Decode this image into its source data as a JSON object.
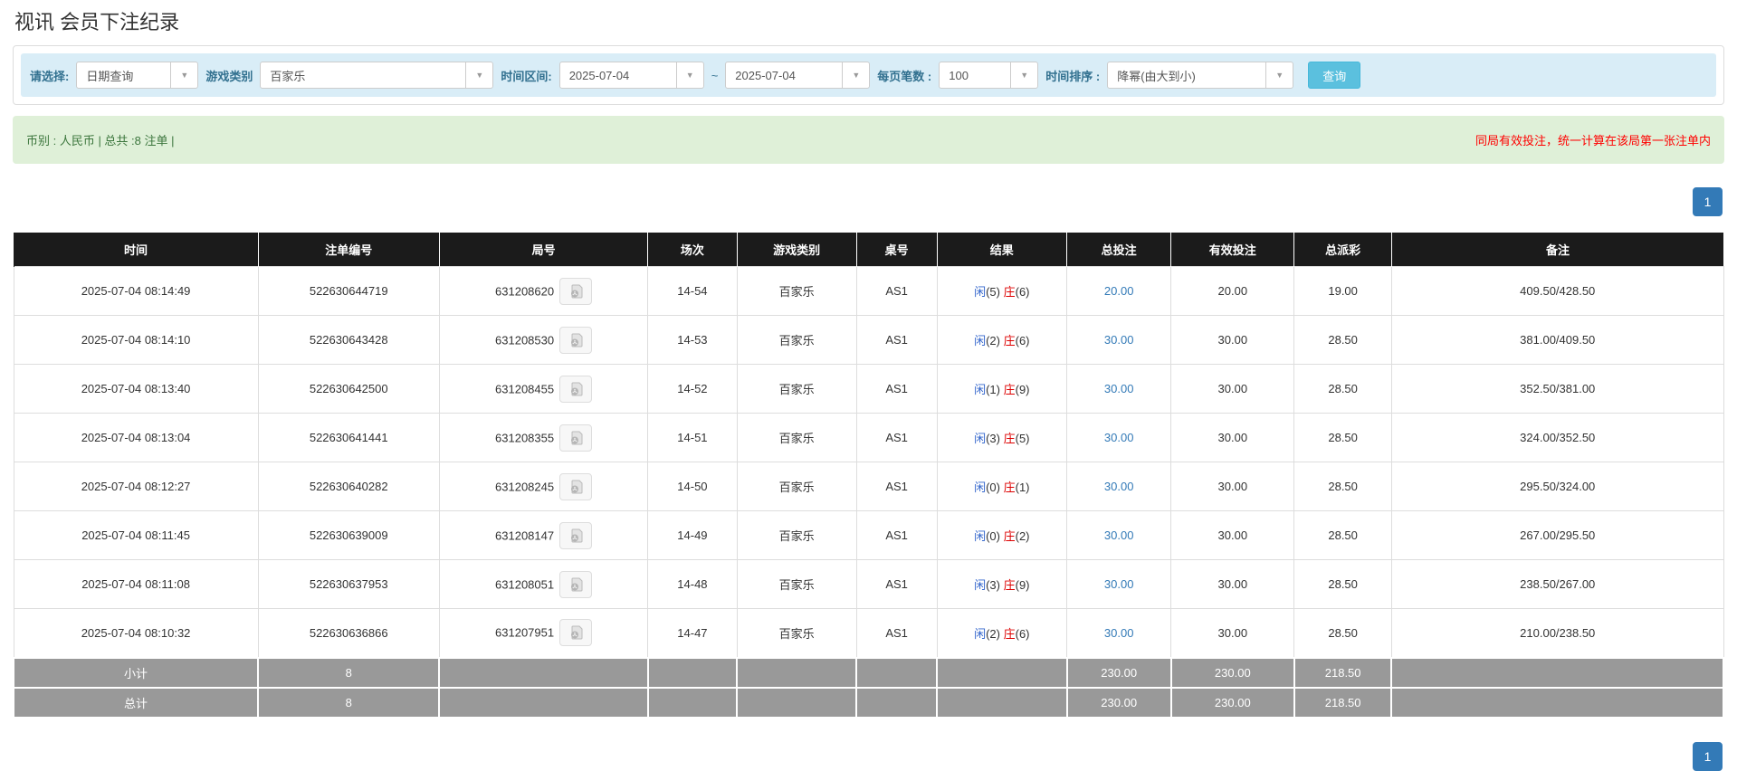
{
  "page": {
    "title": "视讯 会员下注纪录"
  },
  "colors": {
    "accent_blue": "#337ab7",
    "filter_bg": "#d9edf7",
    "label_blue": "#31708f",
    "search_btn": "#5bc0de",
    "info_bg": "#dff0d8",
    "info_text": "#3c763d",
    "notice_red": "#ff0000",
    "header_bg": "#1b1b1b",
    "footer_gray": "#999999",
    "result_player_blue": "#3366cc",
    "result_banker_red": "#dd0000"
  },
  "filters": {
    "choose_label": "请选择:",
    "choose_value": "日期查询",
    "game_label": "游戏类别",
    "game_value": "百家乐",
    "range_label": "时间区间:",
    "range_from": "2025-07-04",
    "range_tilde": "~",
    "range_to": "2025-07-04",
    "per_page_label": "每页笔数 :",
    "per_page_value": "100",
    "sort_label": "时间排序 :",
    "sort_value": "降幂(由大到小)",
    "search_button": "查询",
    "caret": "▼"
  },
  "info": {
    "left": "币别 : 人民币 | 总共 :8 注单 |",
    "right": "同局有效投注，统一计算在该局第一张注单内"
  },
  "pagination": {
    "page": "1"
  },
  "table": {
    "headers": [
      "时间",
      "注单编号",
      "局号",
      "场次",
      "游戏类别",
      "桌号",
      "结果",
      "总投注",
      "有效投注",
      "总派彩",
      "备注"
    ],
    "col_widths": [
      "14.3%",
      "10.6%",
      "12.2%",
      "5.2%",
      "7.0%",
      "4.7%",
      "7.6%",
      "6.1%",
      "7.2%",
      "5.7%",
      "19.4%"
    ],
    "rows": [
      {
        "time": "2025-07-04 08:14:49",
        "bet_id": "522630644719",
        "round_id": "631208620",
        "session": "14-54",
        "game": "百家乐",
        "table_no": "AS1",
        "result": {
          "p": "闲",
          "ps": "(5)",
          "b": "庄",
          "bs": "(6)"
        },
        "total_bet": "20.00",
        "valid_bet": "20.00",
        "payout": "19.00",
        "remark": "409.50/428.50"
      },
      {
        "time": "2025-07-04 08:14:10",
        "bet_id": "522630643428",
        "round_id": "631208530",
        "session": "14-53",
        "game": "百家乐",
        "table_no": "AS1",
        "result": {
          "p": "闲",
          "ps": "(2)",
          "b": "庄",
          "bs": "(6)"
        },
        "total_bet": "30.00",
        "valid_bet": "30.00",
        "payout": "28.50",
        "remark": "381.00/409.50"
      },
      {
        "time": "2025-07-04 08:13:40",
        "bet_id": "522630642500",
        "round_id": "631208455",
        "session": "14-52",
        "game": "百家乐",
        "table_no": "AS1",
        "result": {
          "p": "闲",
          "ps": "(1)",
          "b": "庄",
          "bs": "(9)"
        },
        "total_bet": "30.00",
        "valid_bet": "30.00",
        "payout": "28.50",
        "remark": "352.50/381.00"
      },
      {
        "time": "2025-07-04 08:13:04",
        "bet_id": "522630641441",
        "round_id": "631208355",
        "session": "14-51",
        "game": "百家乐",
        "table_no": "AS1",
        "result": {
          "p": "闲",
          "ps": "(3)",
          "b": "庄",
          "bs": "(5)"
        },
        "total_bet": "30.00",
        "valid_bet": "30.00",
        "payout": "28.50",
        "remark": "324.00/352.50"
      },
      {
        "time": "2025-07-04 08:12:27",
        "bet_id": "522630640282",
        "round_id": "631208245",
        "session": "14-50",
        "game": "百家乐",
        "table_no": "AS1",
        "result": {
          "p": "闲",
          "ps": "(0)",
          "b": "庄",
          "bs": "(1)"
        },
        "total_bet": "30.00",
        "valid_bet": "30.00",
        "payout": "28.50",
        "remark": "295.50/324.00"
      },
      {
        "time": "2025-07-04 08:11:45",
        "bet_id": "522630639009",
        "round_id": "631208147",
        "session": "14-49",
        "game": "百家乐",
        "table_no": "AS1",
        "result": {
          "p": "闲",
          "ps": "(0)",
          "b": "庄",
          "bs": "(2)"
        },
        "total_bet": "30.00",
        "valid_bet": "30.00",
        "payout": "28.50",
        "remark": "267.00/295.50"
      },
      {
        "time": "2025-07-04 08:11:08",
        "bet_id": "522630637953",
        "round_id": "631208051",
        "session": "14-48",
        "game": "百家乐",
        "table_no": "AS1",
        "result": {
          "p": "闲",
          "ps": "(3)",
          "b": "庄",
          "bs": "(9)"
        },
        "total_bet": "30.00",
        "valid_bet": "30.00",
        "payout": "28.50",
        "remark": "238.50/267.00"
      },
      {
        "time": "2025-07-04 08:10:32",
        "bet_id": "522630636866",
        "round_id": "631207951",
        "session": "14-47",
        "game": "百家乐",
        "table_no": "AS1",
        "result": {
          "p": "闲",
          "ps": "(2)",
          "b": "庄",
          "bs": "(6)"
        },
        "total_bet": "30.00",
        "valid_bet": "30.00",
        "payout": "28.50",
        "remark": "210.00/238.50"
      }
    ],
    "footer": [
      {
        "label": "小计",
        "count": "8",
        "total_bet": "230.00",
        "valid_bet": "230.00",
        "payout": "218.50"
      },
      {
        "label": "总计",
        "count": "8",
        "total_bet": "230.00",
        "valid_bet": "230.00",
        "payout": "218.50"
      }
    ]
  }
}
